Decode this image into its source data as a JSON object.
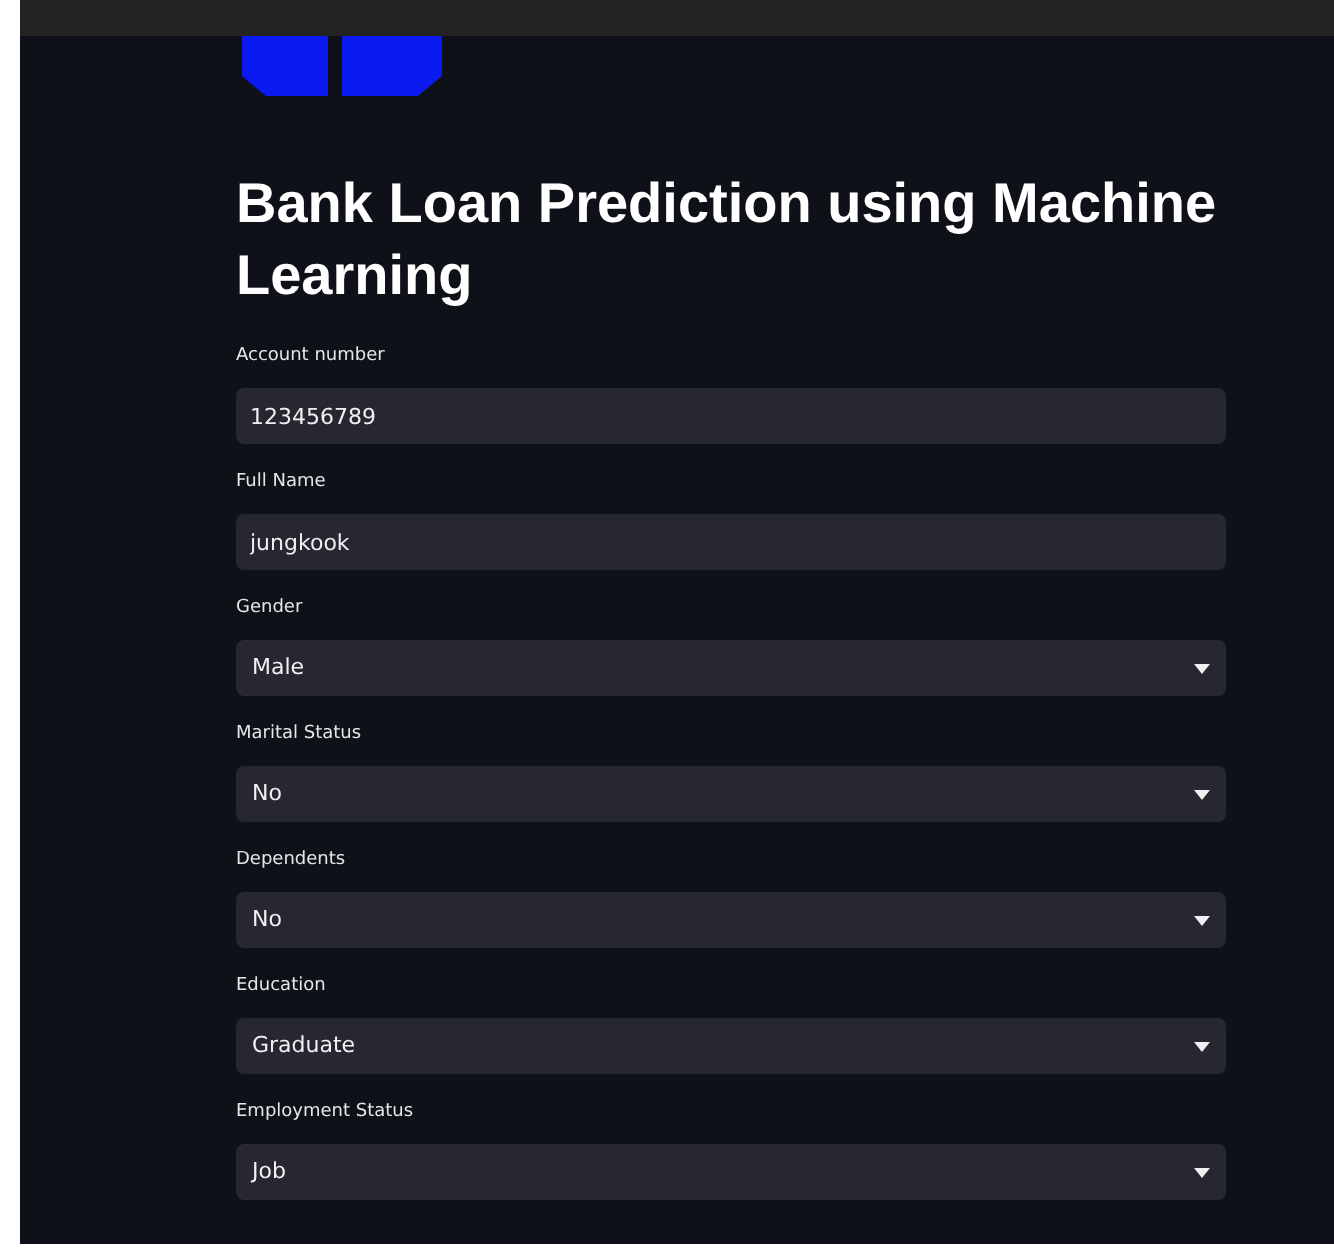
{
  "title": "Bank Loan Prediction using Machine Learning",
  "fields": [
    {
      "kind": "input",
      "label": "Account number",
      "value": "123456789"
    },
    {
      "kind": "input",
      "label": "Full Name",
      "value": "jungkook"
    },
    {
      "kind": "select",
      "label": "Gender",
      "value": "Male"
    },
    {
      "kind": "select",
      "label": "Marital Status",
      "value": "No"
    },
    {
      "kind": "select",
      "label": "Dependents",
      "value": "No"
    },
    {
      "kind": "select",
      "label": "Education",
      "value": "Graduate"
    },
    {
      "kind": "select",
      "label": "Employment Status",
      "value": "Job"
    }
  ]
}
